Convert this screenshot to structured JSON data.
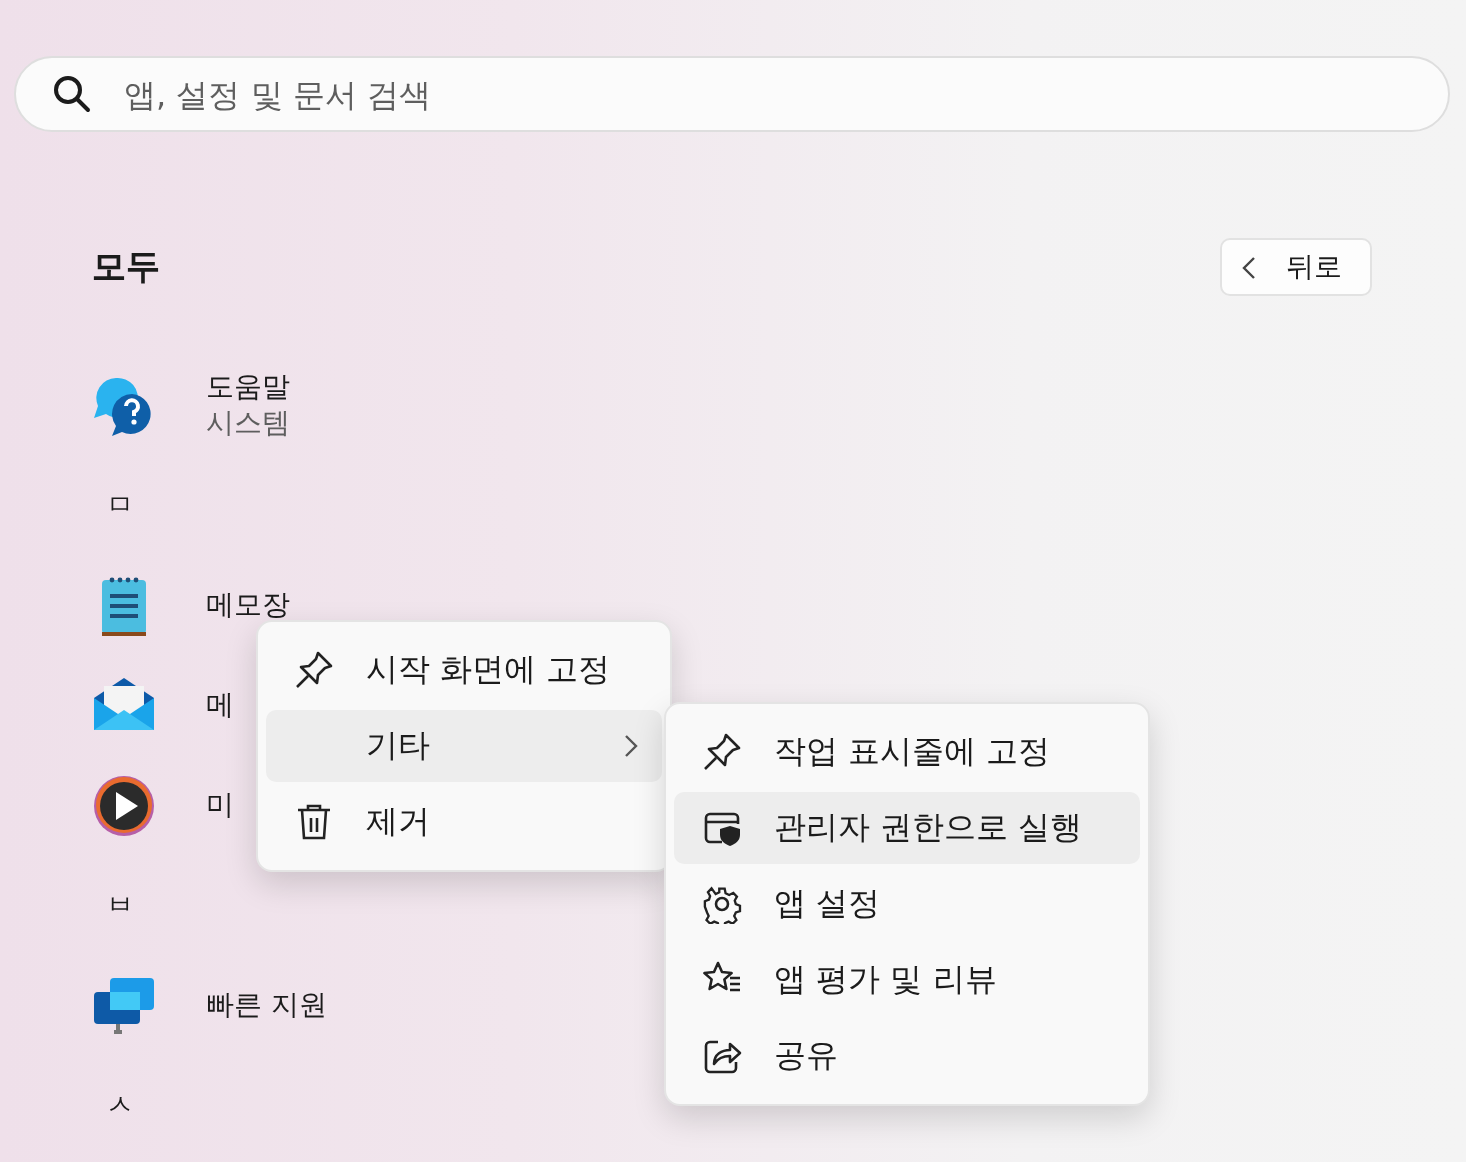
{
  "search": {
    "placeholder": "앱, 설정 및 문서 검색"
  },
  "section": {
    "title": "모두",
    "back_button": "뒤로"
  },
  "apps": [
    {
      "kind": "app",
      "name": "도움말",
      "subtitle": "시스템"
    },
    {
      "kind": "letter",
      "name": "ㅁ"
    },
    {
      "kind": "app",
      "name": "메모장"
    },
    {
      "kind": "app",
      "name": "메"
    },
    {
      "kind": "app",
      "name": "미"
    },
    {
      "kind": "letter",
      "name": "ㅂ"
    },
    {
      "kind": "app",
      "name": "빠른 지원"
    },
    {
      "kind": "letter",
      "name": "ㅅ"
    }
  ],
  "context_menu": {
    "items": [
      {
        "label": "시작 화면에 고정",
        "selected": false,
        "submenu": false
      },
      {
        "label": "기타",
        "selected": true,
        "submenu": true
      },
      {
        "label": "제거",
        "selected": false,
        "submenu": false
      }
    ]
  },
  "submenu": {
    "items": [
      {
        "label": "작업 표시줄에 고정",
        "selected": false
      },
      {
        "label": "관리자 권한으로 실행",
        "selected": true
      },
      {
        "label": "앱 설정",
        "selected": false
      },
      {
        "label": "앱 평가 및 리뷰",
        "selected": false
      },
      {
        "label": "공유",
        "selected": false
      }
    ]
  }
}
